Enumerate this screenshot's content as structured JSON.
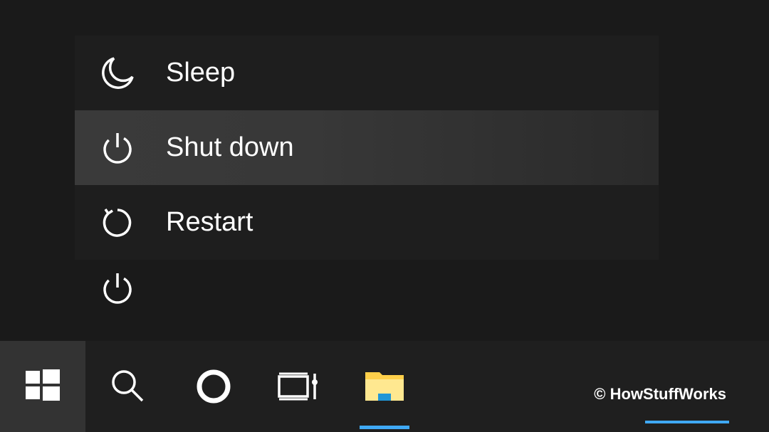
{
  "power_menu": {
    "items": [
      {
        "id": "sleep",
        "label": "Sleep",
        "icon": "moon-icon",
        "hovered": false
      },
      {
        "id": "shutdown",
        "label": "Shut down",
        "icon": "power-icon",
        "hovered": true
      },
      {
        "id": "restart",
        "label": "Restart",
        "icon": "restart-icon",
        "hovered": false
      }
    ]
  },
  "sidebar": {
    "power_button": {
      "icon": "power-icon"
    }
  },
  "taskbar": {
    "items": [
      {
        "id": "start",
        "icon": "windows-logo-icon",
        "active": true,
        "underline": false
      },
      {
        "id": "search",
        "icon": "search-icon",
        "active": false,
        "underline": false
      },
      {
        "id": "cortana",
        "icon": "cortana-icon",
        "active": false,
        "underline": false
      },
      {
        "id": "taskview",
        "icon": "task-view-icon",
        "active": false,
        "underline": false
      },
      {
        "id": "explorer",
        "icon": "file-explorer-icon",
        "active": false,
        "underline": true
      }
    ]
  },
  "attribution": "© HowStuffWorks"
}
